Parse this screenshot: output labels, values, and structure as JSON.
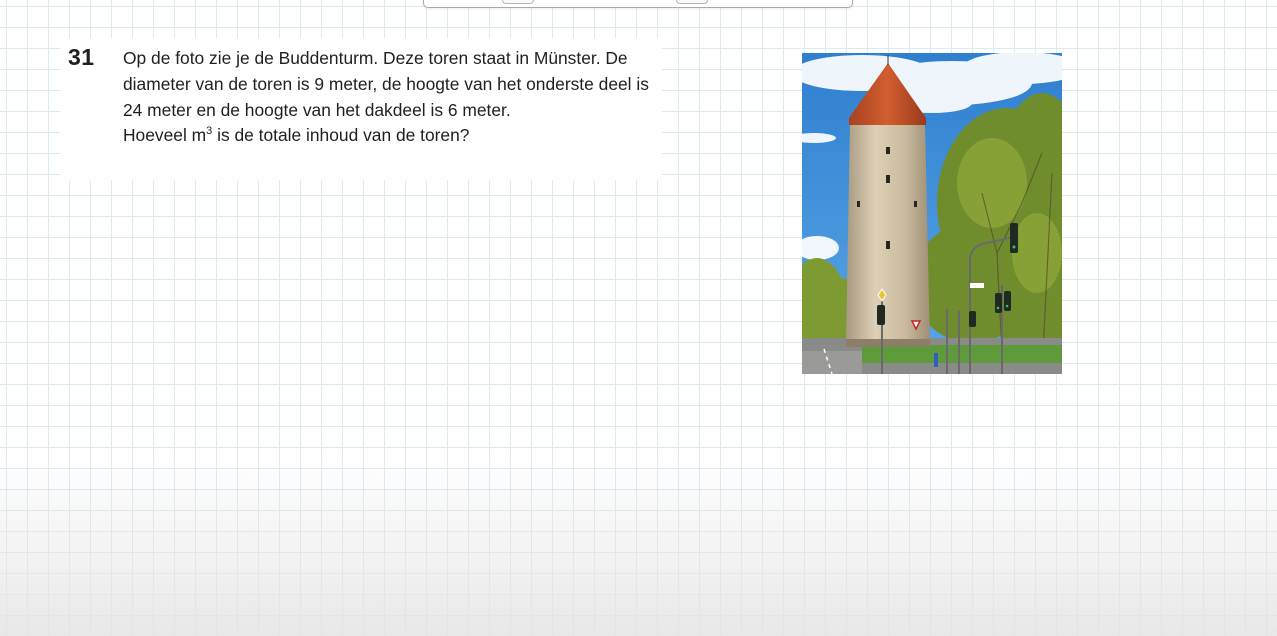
{
  "question": {
    "number": "31",
    "sentence_1": "Op de foto zie je de Buddenturm. Deze toren staat in Münster. De diameter van de toren is 9 meter, de hoogte van het onderste deel is 24 meter en de hoogte van het dakdeel is 6 meter.",
    "question_prefix": "Hoeveel m",
    "question_sup": "3",
    "question_suffix": " is de totale inhoud van de toren?"
  },
  "photo": {
    "subject": "Buddenturm tower photo",
    "colors": {
      "sky": "#3f8fd8",
      "roof": "#c6532a",
      "stone": "#d2c2a6",
      "foliage": "#6f8d2c"
    }
  }
}
